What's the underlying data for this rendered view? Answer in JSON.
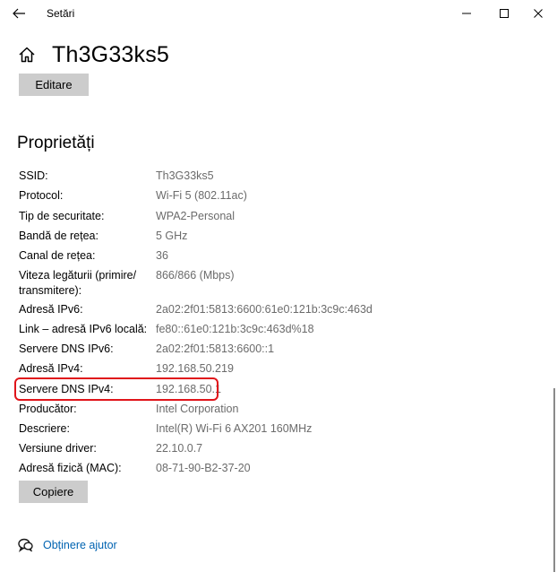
{
  "window": {
    "title": "Setări"
  },
  "header": {
    "network_name": "Th3G33ks5",
    "edit_label": "Editare"
  },
  "properties": {
    "title": "Proprietăți",
    "rows": [
      {
        "label": "SSID:",
        "value": "Th3G33ks5"
      },
      {
        "label": "Protocol:",
        "value": "Wi-Fi 5 (802.11ac)"
      },
      {
        "label": "Tip de securitate:",
        "value": "WPA2-Personal"
      },
      {
        "label": "Bandă de rețea:",
        "value": "5 GHz"
      },
      {
        "label": "Canal de rețea:",
        "value": "36"
      },
      {
        "label": "Viteza legăturii (primire/ transmitere):",
        "value": "866/866 (Mbps)"
      },
      {
        "label": "Adresă IPv6:",
        "value": "2a02:2f01:5813:6600:61e0:121b:3c9c:463d"
      },
      {
        "label": "Link – adresă IPv6 locală:",
        "value": "fe80::61e0:121b:3c9c:463d%18"
      },
      {
        "label": "Servere DNS IPv6:",
        "value": "2a02:2f01:5813:6600::1"
      },
      {
        "label": "Adresă IPv4:",
        "value": "192.168.50.219"
      },
      {
        "label": "Servere DNS IPv4:",
        "value": "192.168.50.1"
      },
      {
        "label": "Producător:",
        "value": "Intel Corporation"
      },
      {
        "label": "Descriere:",
        "value": "Intel(R) Wi-Fi 6 AX201 160MHz"
      },
      {
        "label": "Versiune driver:",
        "value": "22.10.0.7"
      },
      {
        "label": "Adresă fizică (MAC):",
        "value": "08-71-90-B2-37-20"
      }
    ],
    "copy_label": "Copiere"
  },
  "help": {
    "label": "Obținere ajutor"
  },
  "colors": {
    "highlight": "#e0141a",
    "link": "#0063b1",
    "button": "#cccccc",
    "value_text": "#6b6b6b"
  }
}
